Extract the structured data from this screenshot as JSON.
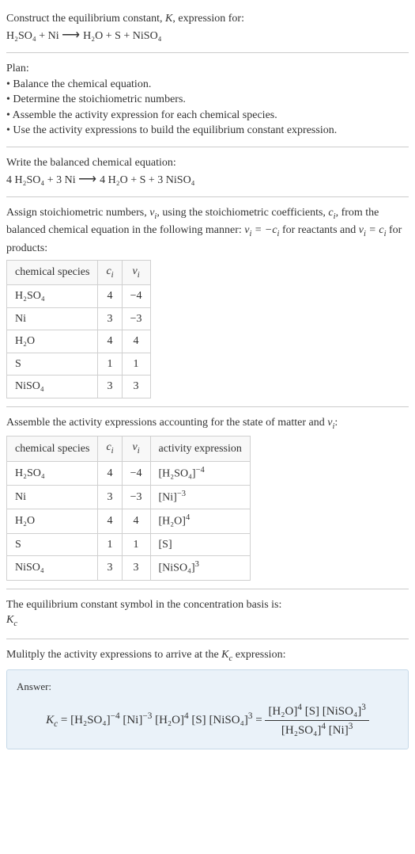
{
  "intro": {
    "line1_a": "Construct the equilibrium constant, ",
    "line1_b": ", expression for:",
    "eq_lhs": "H₂SO₄ + Ni",
    "eq_rhs": "H₂O + S + NiSO₄"
  },
  "plan": {
    "title": "Plan:",
    "steps": [
      "• Balance the chemical equation.",
      "• Determine the stoichiometric numbers.",
      "• Assemble the activity expression for each chemical species.",
      "• Use the activity expressions to build the equilibrium constant expression."
    ]
  },
  "balanced": {
    "title": "Write the balanced chemical equation:",
    "lhs": "4 H₂SO₄ + 3 Ni",
    "rhs": "4 H₂O + S + 3 NiSO₄"
  },
  "assign": {
    "text_a": "Assign stoichiometric numbers, ",
    "text_b": ", using the stoichiometric coefficients, ",
    "text_c": ", from the balanced chemical equation in the following manner: ",
    "text_d": " for reactants and ",
    "text_e": " for products:",
    "headers": [
      "chemical species",
      "cᵢ",
      "νᵢ"
    ],
    "rows": [
      [
        "H₂SO₄",
        "4",
        "−4"
      ],
      [
        "Ni",
        "3",
        "−3"
      ],
      [
        "H₂O",
        "4",
        "4"
      ],
      [
        "S",
        "1",
        "1"
      ],
      [
        "NiSO₄",
        "3",
        "3"
      ]
    ]
  },
  "activity": {
    "text_a": "Assemble the activity expressions accounting for the state of matter and ",
    "text_b": ":",
    "headers": [
      "chemical species",
      "cᵢ",
      "νᵢ",
      "activity expression"
    ],
    "rows": [
      {
        "sp": "H₂SO₄",
        "c": "4",
        "v": "−4",
        "expr_base": "[H₂SO₄]",
        "expr_pow": "−4"
      },
      {
        "sp": "Ni",
        "c": "3",
        "v": "−3",
        "expr_base": "[Ni]",
        "expr_pow": "−3"
      },
      {
        "sp": "H₂O",
        "c": "4",
        "v": "4",
        "expr_base": "[H₂O]",
        "expr_pow": "4"
      },
      {
        "sp": "S",
        "c": "1",
        "v": "1",
        "expr_base": "[S]",
        "expr_pow": ""
      },
      {
        "sp": "NiSO₄",
        "c": "3",
        "v": "3",
        "expr_base": "[NiSO₄]",
        "expr_pow": "3"
      }
    ]
  },
  "symbol": {
    "line1": "The equilibrium constant symbol in the concentration basis is:",
    "kc": "K",
    "kc_sub": "c"
  },
  "multiply": {
    "text_a": "Mulitply the activity expressions to arrive at the ",
    "text_b": " expression:"
  },
  "answer": {
    "label": "Answer:",
    "kc": "K",
    "kc_sub": "c",
    "eq": " = ",
    "lhs_terms": [
      {
        "base": "[H₂SO₄]",
        "pow": "−4"
      },
      {
        "base": "[Ni]",
        "pow": "−3"
      },
      {
        "base": "[H₂O]",
        "pow": "4"
      },
      {
        "base": "[S]",
        "pow": ""
      },
      {
        "base": "[NiSO₄]",
        "pow": "3"
      }
    ],
    "frac_num": [
      {
        "base": "[H₂O]",
        "pow": "4"
      },
      {
        "base": "[S]",
        "pow": ""
      },
      {
        "base": "[NiSO₄]",
        "pow": "3"
      }
    ],
    "frac_den": [
      {
        "base": "[H₂SO₄]",
        "pow": "4"
      },
      {
        "base": "[Ni]",
        "pow": "3"
      }
    ]
  },
  "chart_data": {
    "type": "table",
    "tables": [
      {
        "title": "Stoichiometric numbers",
        "columns": [
          "chemical species",
          "c_i",
          "nu_i"
        ],
        "rows": [
          [
            "H2SO4",
            4,
            -4
          ],
          [
            "Ni",
            3,
            -3
          ],
          [
            "H2O",
            4,
            4
          ],
          [
            "S",
            1,
            1
          ],
          [
            "NiSO4",
            3,
            3
          ]
        ]
      },
      {
        "title": "Activity expressions",
        "columns": [
          "chemical species",
          "c_i",
          "nu_i",
          "activity expression"
        ],
        "rows": [
          [
            "H2SO4",
            4,
            -4,
            "[H2SO4]^-4"
          ],
          [
            "Ni",
            3,
            -3,
            "[Ni]^-3"
          ],
          [
            "H2O",
            4,
            4,
            "[H2O]^4"
          ],
          [
            "S",
            1,
            1,
            "[S]"
          ],
          [
            "NiSO4",
            3,
            3,
            "[NiSO4]^3"
          ]
        ]
      }
    ]
  }
}
